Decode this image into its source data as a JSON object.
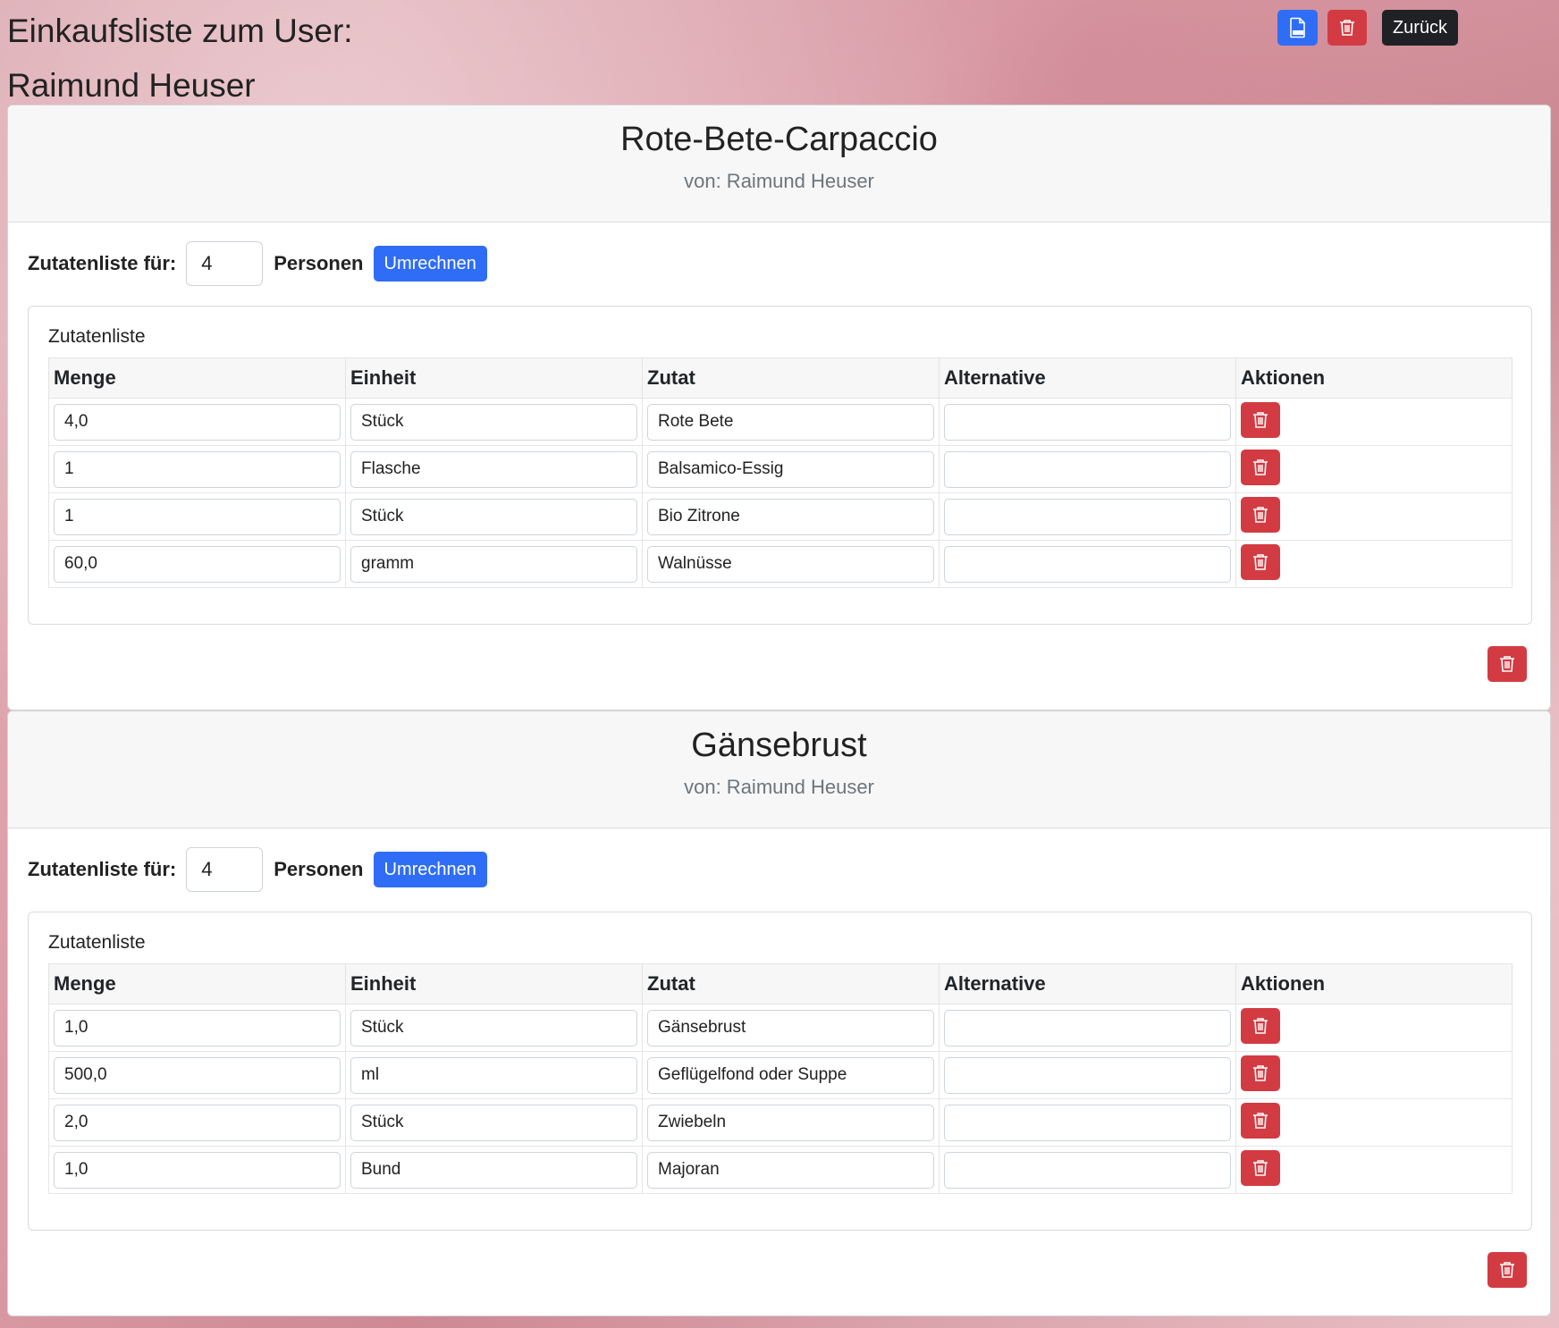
{
  "header": {
    "title": "Einkaufsliste zum User: Raimund Heuser",
    "back_label": "Zurück"
  },
  "icons": {
    "pdf": "file-pdf-icon",
    "trash": "trash-icon"
  },
  "colors": {
    "primary": "#2f6df6",
    "danger": "#d33b43",
    "dark": "#1f2125"
  },
  "labels": {
    "servings_prefix": "Zutatenliste für:",
    "servings_suffix": "Personen",
    "convert": "Umrechnen",
    "list_caption": "Zutatenliste",
    "columns": [
      "Menge",
      "Einheit",
      "Zutat",
      "Alternative",
      "Aktionen"
    ]
  },
  "recipes": [
    {
      "title": "Rote-Bete-Carpaccio",
      "author": "von: Raimund Heuser",
      "servings": "4",
      "ingredients": [
        {
          "menge": "4,0",
          "einheit": "Stück",
          "zutat": "Rote Bete",
          "alternative": ""
        },
        {
          "menge": "1",
          "einheit": "Flasche",
          "zutat": "Balsamico-Essig",
          "alternative": ""
        },
        {
          "menge": "1",
          "einheit": "Stück",
          "zutat": "Bio Zitrone",
          "alternative": ""
        },
        {
          "menge": "60,0",
          "einheit": "gramm",
          "zutat": "Walnüsse",
          "alternative": ""
        }
      ]
    },
    {
      "title": "Gänsebrust",
      "author": "von: Raimund Heuser",
      "servings": "4",
      "ingredients": [
        {
          "menge": "1,0",
          "einheit": "Stück",
          "zutat": "Gänsebrust",
          "alternative": ""
        },
        {
          "menge": "500,0",
          "einheit": "ml",
          "zutat": "Geflügelfond oder Suppe",
          "alternative": ""
        },
        {
          "menge": "2,0",
          "einheit": "Stück",
          "zutat": "Zwiebeln",
          "alternative": ""
        },
        {
          "menge": "1,0",
          "einheit": "Bund",
          "zutat": "Majoran",
          "alternative": ""
        }
      ]
    }
  ]
}
